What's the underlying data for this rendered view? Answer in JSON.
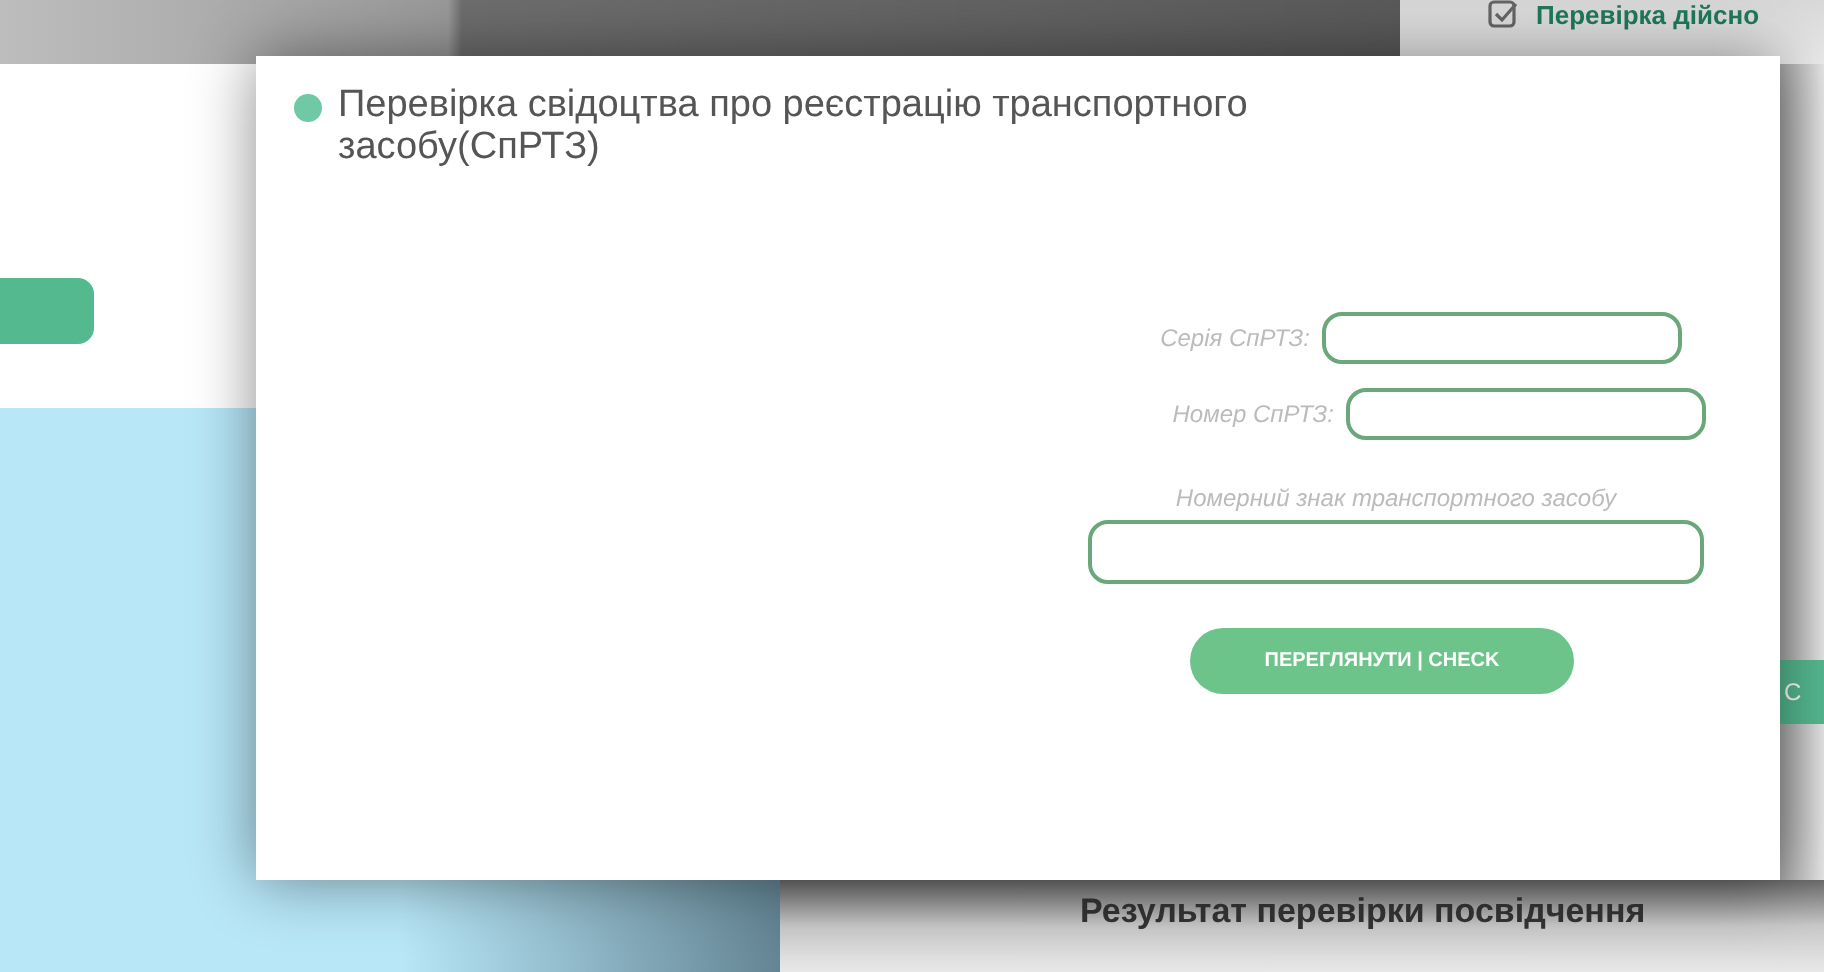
{
  "background": {
    "top_link": "Перевірка дійсно",
    "side_button": "С",
    "result_heading": "Результат перевірки посвідчення"
  },
  "dialog": {
    "title": "Перевірка свідоцтва про реєстрацію транспортного засобу(СпРТЗ)",
    "fields": [
      {
        "kind": "inline",
        "label": "Серія СпРТЗ:"
      },
      {
        "kind": "inline",
        "label": "Номер СпРТЗ:"
      },
      {
        "kind": "stacked",
        "label": "Номерний знак транспортного засобу"
      }
    ],
    "button": "ПЕРЕГЛЯНУТИ | CHECK"
  }
}
